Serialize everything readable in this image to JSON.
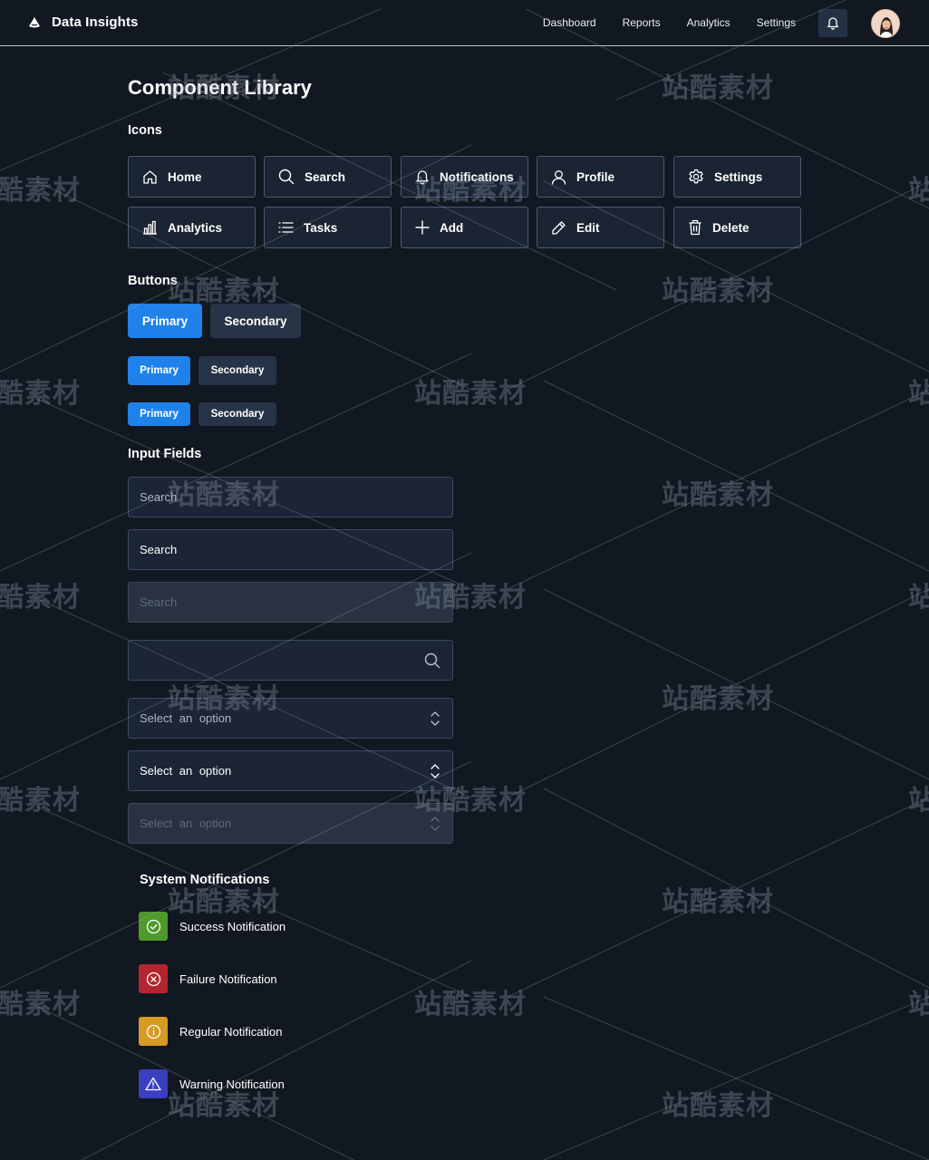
{
  "header": {
    "brand": "Data Insights",
    "nav": [
      "Dashboard",
      "Reports",
      "Analytics",
      "Settings"
    ]
  },
  "page_title": "Component Library",
  "sections": {
    "icons": "Icons",
    "buttons": "Buttons",
    "inputs": "Input Fields",
    "notifications": "System Notifications"
  },
  "icon_tiles": [
    {
      "label": "Home",
      "icon": "home-icon"
    },
    {
      "label": "Search",
      "icon": "search-icon"
    },
    {
      "label": "Notifications",
      "icon": "bell-icon"
    },
    {
      "label": "Profile",
      "icon": "user-icon"
    },
    {
      "label": "Settings",
      "icon": "gear-icon"
    },
    {
      "label": "Analytics",
      "icon": "bar-chart-icon"
    },
    {
      "label": "Tasks",
      "icon": "list-icon"
    },
    {
      "label": "Add",
      "icon": "plus-icon"
    },
    {
      "label": "Edit",
      "icon": "pencil-icon"
    },
    {
      "label": "Delete",
      "icon": "trash-icon"
    }
  ],
  "buttons": {
    "primary": "Primary",
    "secondary": "Secondary"
  },
  "inputs": {
    "search_placeholder": "Search",
    "search_value": "Search",
    "search_disabled": "Search",
    "select_placeholder": "Select  an  option",
    "select_value": "Select  an  option",
    "select_disabled": "Select  an  option"
  },
  "notifications": [
    {
      "label": "Success Notification",
      "color": "#4e9a2a",
      "icon": "check-circle-icon"
    },
    {
      "label": "Failure Notification",
      "color": "#b3262f",
      "icon": "x-circle-icon"
    },
    {
      "label": "Regular Notification",
      "color": "#d79a24",
      "icon": "info-circle-icon"
    },
    {
      "label": "Warning Notification",
      "color": "#3a3ec0",
      "icon": "warning-triangle-icon"
    }
  ],
  "colors": {
    "background": "#121821",
    "primary": "#1f82ea",
    "secondary": "#273447"
  },
  "watermark": "站酷素材"
}
